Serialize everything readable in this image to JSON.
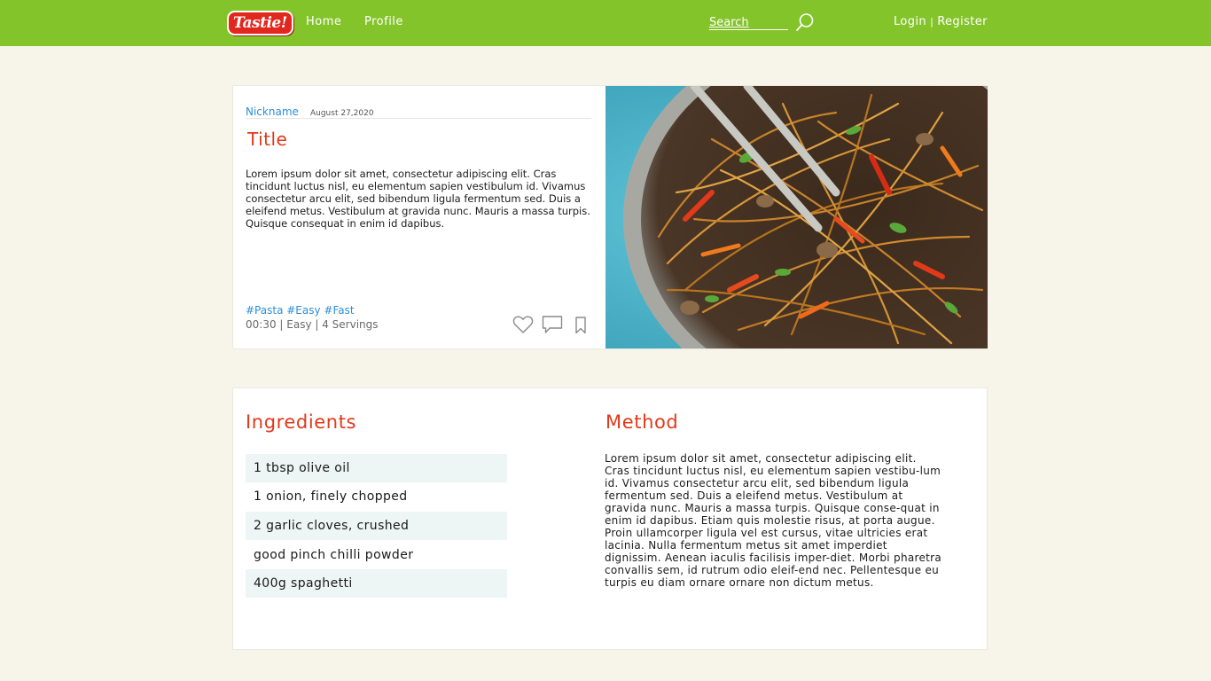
{
  "nav": {
    "logo_text": "Tastie!",
    "home_label": "Home",
    "profile_label": "Profile",
    "search_placeholder": "Search",
    "login_label": "Login",
    "separator": "|",
    "register_label": "Register"
  },
  "recipe": {
    "nickname": "Nickname",
    "date": "August 27,2020",
    "title": "Title",
    "description": "Lorem ipsum dolor sit amet, consectetur adipiscing elit. Cras tincidunt luctus nisl, eu elementum sapien vestibulum id. Vivamus consectetur arcu elit, sed bibendum ligula fermentum sed. Duis a eleifend metus. Vestibulum at gravida nunc. Mauris a massa turpis. Quisque consequat in enim id dapibus.",
    "tags": [
      "#Pasta",
      "#Easy",
      "#Fast"
    ],
    "time": "00:30",
    "difficulty": "Easy",
    "servings": "4 Servings",
    "details_separator": " | ",
    "icons": {
      "like": "heart-icon",
      "comment": "comment-icon",
      "save": "bookmark-icon"
    },
    "image_subject": "noodle stir-fry with vegetables in pan"
  },
  "ingredients": {
    "heading": "Ingredients",
    "items": [
      "1 tbsp olive oil",
      "1 onion, finely chopped",
      "2 garlic cloves, crushed",
      "good pinch chilli powder",
      "400g spaghetti"
    ]
  },
  "method": {
    "heading": "Method",
    "text": "Lorem ipsum dolor sit amet, consectetur adipiscing elit. Cras tincidunt luctus nisl, eu elementum sapien vestibu-lum id. Vivamus consectetur arcu elit, sed bibendum ligula fermentum sed. Duis a eleifend metus. Vestibulum at gravida nunc. Mauris a massa turpis. Quisque conse-quat in enim id dapibus. Etiam quis molestie risus, at porta augue. Proin ullamcorper ligula vel est cursus, vitae ultricies erat lacinia. Nulla fermentum metus sit amet imperdiet dignissim. Aenean iaculis facilisis imper-diet. Morbi pharetra convallis sem, id rutrum odio eleif-end nec. Pellentesque eu turpis eu diam ornare ornare non dictum metus."
  },
  "colors": {
    "nav_bar": "#84c42b",
    "page_background": "#f7f4ea",
    "accent_heading": "#e2391b",
    "link_blue": "#2c8fd6",
    "logo_red": "#e2281e",
    "ingredient_row": "#eef5f5"
  }
}
